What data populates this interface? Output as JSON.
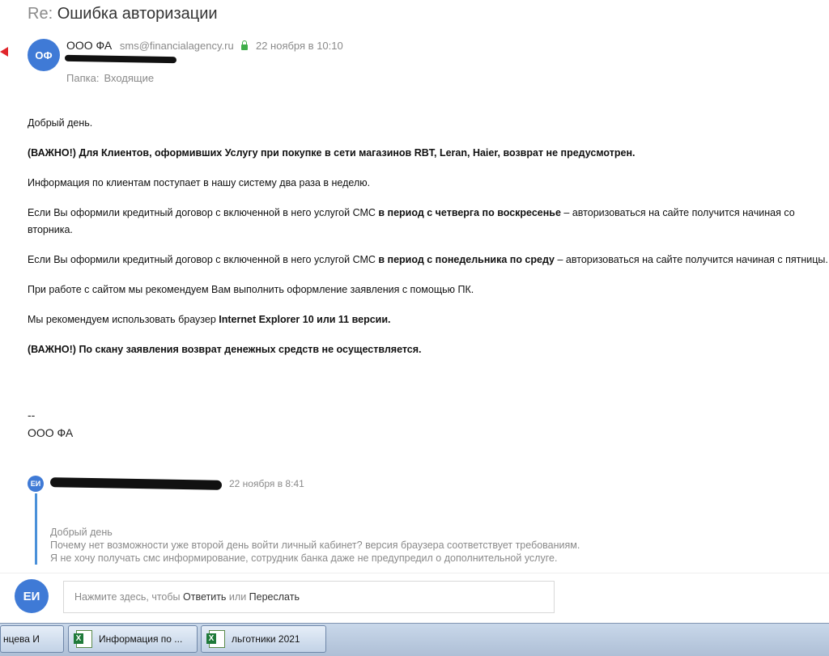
{
  "subject": {
    "prefix": "Re:",
    "title": "Ошибка авторизации"
  },
  "message": {
    "avatar_initials": "ОФ",
    "sender_name": "ООО ФА",
    "sender_email": "sms@financialagency.ru",
    "date": "22 ноября в 10:10",
    "folder_label": "Папка:",
    "folder_value": "Входящие",
    "body": {
      "p1": "Добрый день.",
      "p2": "(ВАЖНО!) Для Клиентов, оформивших Услугу при покупке в сети магазинов RBT, Leran, Haier, возврат не предусмотрен.",
      "p3": "Информация по клиентам поступает в нашу систему два раза в неделю.",
      "p4_a": "Если Вы оформили кредитный договор с включенной в него услугой СМС ",
      "p4_b": "в период с четверга по воскресенье",
      "p4_c": " – авторизоваться на сайте получится начиная со вторника.",
      "p5_a": "Если Вы оформили кредитный договор с включенной в него услугой СМС ",
      "p5_b": "в период с понедельника по среду",
      "p5_c": " – авторизоваться на сайте получится начиная с пятницы.",
      "p6": "При работе с сайтом мы рекомендуем Вам выполнить оформление заявления с помощью ПК.",
      "p7_a": "Мы рекомендуем использовать браузер ",
      "p7_b": "Internet Explorer 10 или 11 версии.",
      "p8": "(ВАЖНО!) По скану заявления возврат денежных средств не осуществляется."
    },
    "signature_dash": "--",
    "signature_name": "ООО ФА"
  },
  "quoted": {
    "avatar_initials": "ЕИ",
    "date": "22 ноября в 8:41",
    "line1": "Добрый день",
    "line2": "Почему нет возможности уже второй день войти личный кабинет? версия браузера соответствует требованиям.",
    "line3": "Я не хочу получать смс информирование, сотрудник банка даже не предупредил о дополнительной услуге."
  },
  "reply": {
    "avatar_initials": "ЕИ",
    "prompt_prefix": "Нажмите здесь, чтобы ",
    "reply_link": "Ответить",
    "or_text": " или ",
    "forward_link": "Переслать"
  },
  "taskbar": {
    "items": [
      {
        "label": "нцева И"
      },
      {
        "label": "Информация по ..."
      },
      {
        "label": "льготники 2021"
      }
    ]
  },
  "colors": {
    "avatar": "#3f7ad6",
    "quote_bar": "#4a90d9",
    "lock": "#3fae4a",
    "arrow": "#e0262b"
  }
}
